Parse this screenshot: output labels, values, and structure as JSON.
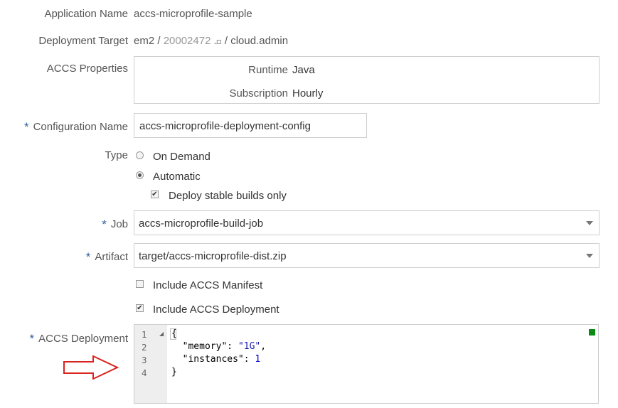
{
  "form": {
    "app_name_label": "Application Name",
    "app_name_value": "accs-microprofile-sample",
    "deploy_target_label": "Deployment Target",
    "deploy_target_prefix": "em2 / ",
    "deploy_target_masked": "ܩ    20002472",
    "deploy_target_suffix": " / cloud.admin",
    "accs_props_label": "ACCS Properties",
    "props": {
      "runtime_label": "Runtime",
      "runtime_value": "Java",
      "subscription_label": "Subscription",
      "subscription_value": "Hourly"
    },
    "required_mark": "*",
    "config_name_label": "Configuration Name",
    "config_name_value": "accs-microprofile-deployment-config",
    "type_label": "Type",
    "type_on_demand": "On Demand",
    "type_automatic": "Automatic",
    "deploy_stable": "Deploy stable builds only",
    "job_label": "Job",
    "job_value": "accs-microprofile-build-job",
    "artifact_label": "Artifact",
    "artifact_value": "target/accs-microprofile-dist.zip",
    "include_manifest": "Include ACCS Manifest",
    "include_deployment": "Include ACCS Deployment",
    "accs_deployment_label": "ACCS Deployment",
    "checkmark": "✔"
  },
  "editor": {
    "line_numbers": [
      "1",
      "2",
      "3",
      "4"
    ],
    "line1": "{",
    "line2_key": "  \"memory\"",
    "line2_sep": ": ",
    "line2_val": "\"1G\"",
    "line2_end": ",",
    "line3_key": "  \"instances\"",
    "line3_sep": ": ",
    "line3_val": "1",
    "line4": "}",
    "fold_glyph": "◢"
  },
  "colors": {
    "accent_required": "#2e5f9e",
    "status_ok": "#0a8a16",
    "arrow": "#d9231d"
  }
}
